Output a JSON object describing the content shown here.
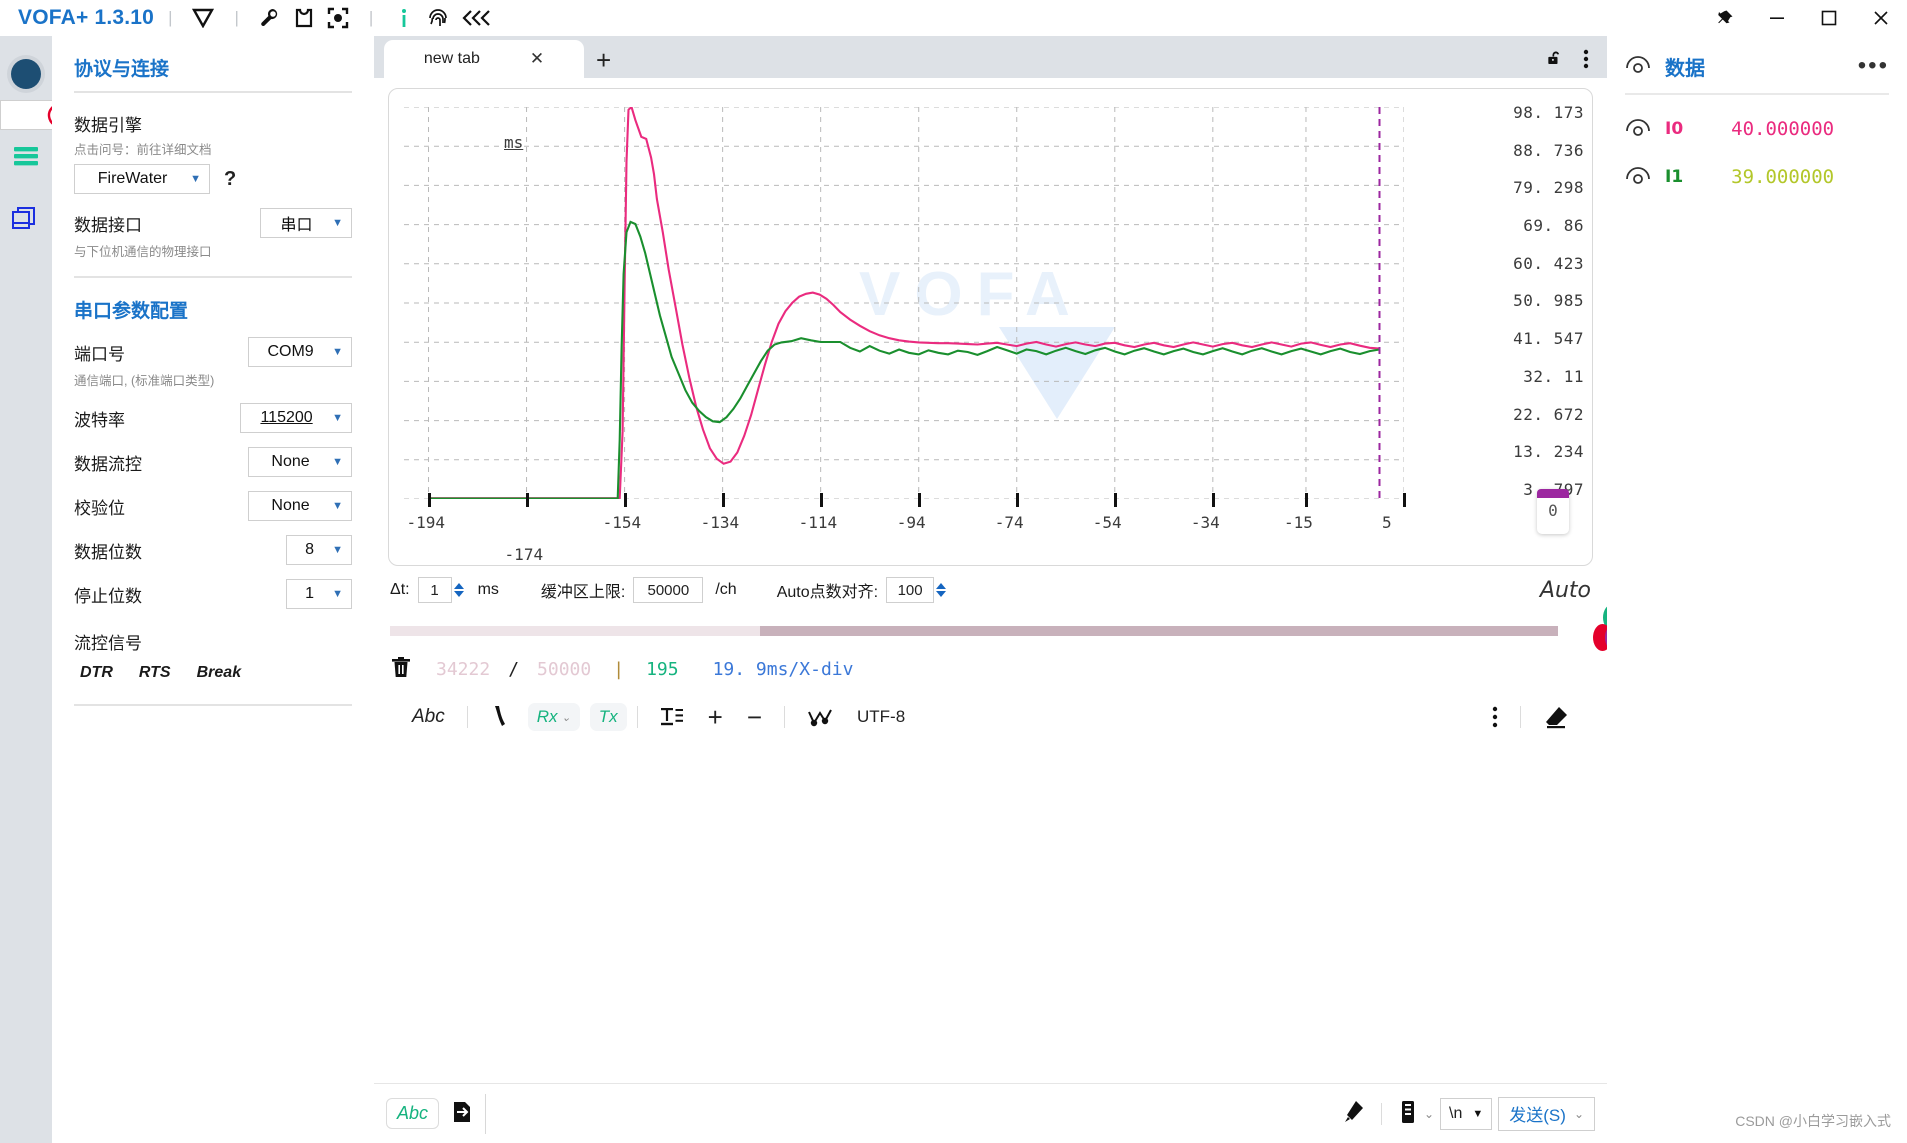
{
  "titlebar": {
    "brand": "VOFA+ 1.3.10",
    "icons": [
      {
        "name": "vofa-logo-icon",
        "glyph": "V"
      },
      {
        "name": "wrench-icon",
        "glyph": "wrench"
      },
      {
        "name": "shirt-icon",
        "glyph": "shirt"
      },
      {
        "name": "focus-icon",
        "glyph": "focus"
      },
      {
        "name": "info-icon",
        "glyph": "i"
      },
      {
        "name": "fingerprint-icon",
        "glyph": "fingerprint"
      },
      {
        "name": "collapse-icon",
        "glyph": "«‹"
      }
    ],
    "window": {
      "pin": "pin-icon",
      "minimize": "–",
      "maximize": "☐",
      "close": "✕"
    }
  },
  "rail": {
    "items": [
      {
        "name": "connection-status-indicator",
        "selected": false
      },
      {
        "name": "record-icon",
        "selected": true
      },
      {
        "name": "menu-lines-icon",
        "selected": false
      },
      {
        "name": "windows-stack-icon",
        "selected": false
      }
    ]
  },
  "sidebar": {
    "section1_title": "协议与连接",
    "engine": {
      "label": "数据引擎",
      "hint": "点击问号：前往详细文档",
      "value": "FireWater",
      "help": "?"
    },
    "interface": {
      "label": "数据接口",
      "value": "串口",
      "hint": "与下位机通信的物理接口"
    },
    "section2_title": "串口参数配置",
    "port": {
      "label": "端口号",
      "value": "COM9",
      "hint": "通信端口, (标准端口类型)"
    },
    "rows": [
      {
        "label": "波特率",
        "value": "115200",
        "underline": true
      },
      {
        "label": "数据流控",
        "value": "None",
        "underline": false
      },
      {
        "label": "校验位",
        "value": "None",
        "underline": false
      },
      {
        "label": "数据位数",
        "value": "8",
        "underline": false
      },
      {
        "label": "停止位数",
        "value": "1",
        "underline": false
      }
    ],
    "flow": {
      "label": "流控信号",
      "buttons": [
        "DTR",
        "RTS",
        "Break"
      ]
    }
  },
  "tabs": {
    "items": [
      {
        "label": "new tab",
        "close": "✕"
      }
    ],
    "add": "+",
    "lock_icon": "unlock-icon",
    "more_icon": "kebab-menu-icon"
  },
  "chart_data": {
    "type": "line",
    "title": "",
    "xlabel": "ms",
    "ylabel": "",
    "grid": true,
    "legend_position": "right-panel",
    "xtick_labels": [
      "-194",
      "-174",
      "-154",
      "-134",
      "-114",
      "-94",
      "-74",
      "-54",
      "-34",
      "-15",
      "5"
    ],
    "xlim": [
      -199,
      5
    ],
    "ytick_labels": [
      "98. 173",
      "88. 736",
      "79. 298",
      "69. 86",
      "60. 423",
      "50. 985",
      "41. 547",
      "32. 11",
      "22. 672",
      "13. 234",
      "3. 797"
    ],
    "ylim": [
      3.797,
      98.173
    ],
    "cursor": {
      "label": "0",
      "value_at_cursor_x": 0
    },
    "watermark": "VOFA",
    "series": [
      {
        "name": "I0",
        "color": "#ea2b7f",
        "value": "40.000000",
        "x": [
          -194,
          -180,
          -170,
          -162,
          -158,
          -155,
          -154.4,
          -154.0,
          -153.6,
          -153.2,
          -152.6,
          -151.8,
          -150.6,
          -149.6,
          -148.6,
          -148.0,
          -147.4,
          -146.2,
          -145.0,
          -143.6,
          -142.2,
          -140.8,
          -139.4,
          -138.0,
          -136.6,
          -135.2,
          -133.8,
          -132.4,
          -131.0,
          -129.6,
          -128.2,
          -126.8,
          -125.4,
          -124.0,
          -122.6,
          -121.2,
          -119.8,
          -118.4,
          -117.0,
          -115.6,
          -114.2,
          -112.8,
          -111.4,
          -110.0,
          -108,
          -106,
          -104,
          -102,
          -100,
          -98,
          -96,
          -94,
          -92,
          -90,
          -88,
          -86,
          -84,
          -82,
          -80,
          -78,
          -76,
          -74,
          -72,
          -70,
          -68,
          -66,
          -64,
          -62,
          -60,
          -58,
          -56,
          -54,
          -52,
          -50,
          -48,
          -46,
          -44,
          -42,
          -40,
          -38,
          -36,
          -34,
          -32,
          -30,
          -28,
          -26,
          -24,
          -22,
          -20,
          -18,
          -16,
          -14,
          -12,
          -10,
          -8,
          -6,
          -4,
          -2,
          0
        ],
        "y": [
          4.0,
          4.0,
          4.0,
          4.0,
          4.0,
          4.0,
          20,
          55,
          85,
          97.5,
          98.2,
          95,
          91,
          90.5,
          86,
          82,
          76,
          68,
          59,
          50,
          41,
          33,
          26,
          20.5,
          16,
          13.5,
          12.3,
          12.8,
          15,
          19,
          24,
          30,
          36,
          41.5,
          46,
          49,
          51,
          52.5,
          53.2,
          53.5,
          53.0,
          52,
          50.5,
          48.8,
          47.0,
          45.5,
          44.2,
          43.2,
          42.5,
          42.0,
          41.7,
          41.5,
          41.4,
          41.3,
          41.3,
          41.2,
          41.1,
          41.0,
          41.2,
          41.4,
          41.0,
          40.6,
          41.2,
          41.6,
          41.0,
          40.5,
          41.1,
          41.5,
          41.0,
          40.6,
          41.2,
          41.4,
          40.8,
          40.4,
          41.0,
          41.4,
          40.8,
          40.4,
          41.0,
          41.5,
          41.0,
          40.5,
          41.1,
          41.4,
          40.8,
          40.4,
          41.0,
          41.5,
          41.0,
          40.5,
          41.2,
          41.5,
          40.9,
          40.4,
          41.0,
          41.3,
          40.7,
          40.2,
          40.0
        ]
      },
      {
        "name": "I1",
        "color": "#1a8f2e",
        "value": "39.000000",
        "x": [
          -194,
          -180,
          -170,
          -162,
          -158,
          -155.4,
          -155.0,
          -154.6,
          -154.2,
          -153.6,
          -152.8,
          -151.8,
          -150.8,
          -149.8,
          -148.8,
          -147.8,
          -146.8,
          -145.6,
          -144.4,
          -143.0,
          -141.6,
          -140.2,
          -138.8,
          -137.4,
          -136.0,
          -134.6,
          -133.2,
          -131.8,
          -130.4,
          -129.0,
          -127.6,
          -126.2,
          -124.8,
          -123.4,
          -122.0,
          -120,
          -118,
          -116,
          -114,
          -112,
          -110,
          -108,
          -106,
          -104,
          -102,
          -100,
          -98,
          -96,
          -94,
          -92,
          -90,
          -88,
          -86,
          -84,
          -82,
          -80,
          -78,
          -76,
          -74,
          -72,
          -70,
          -68,
          -66,
          -64,
          -62,
          -60,
          -58,
          -56,
          -54,
          -52,
          -50,
          -48,
          -46,
          -44,
          -42,
          -40,
          -38,
          -36,
          -34,
          -32,
          -30,
          -28,
          -26,
          -24,
          -22,
          -20,
          -18,
          -16,
          -14,
          -12,
          -10,
          -8,
          -6,
          -4,
          -2,
          0
        ],
        "y": [
          3.9,
          3.9,
          3.9,
          3.9,
          3.9,
          3.9,
          18,
          40,
          58,
          68,
          70.5,
          70.0,
          67,
          63,
          58,
          53,
          48,
          43,
          38,
          34,
          30,
          27,
          25,
          23.5,
          22.5,
          22.3,
          23.5,
          25.5,
          28,
          31,
          34,
          37,
          39.5,
          41,
          41.5,
          41.8,
          42.5,
          42.0,
          41.6,
          41.6,
          41.6,
          40.2,
          39.3,
          40.6,
          39.5,
          38.8,
          39.8,
          39.0,
          38.6,
          39.6,
          39.0,
          38.6,
          39.5,
          39.2,
          38.5,
          39.4,
          40.4,
          39.6,
          38.8,
          39.8,
          39.4,
          38.6,
          39.5,
          40.2,
          39.4,
          38.7,
          39.6,
          40.2,
          39.3,
          38.6,
          39.5,
          40.1,
          39.3,
          38.6,
          39.4,
          40.0,
          39.2,
          38.6,
          39.4,
          40.1,
          39.3,
          38.6,
          39.5,
          40.1,
          39.3,
          38.6,
          39.4,
          40.0,
          39.3,
          38.6,
          39.4,
          40.0,
          39.2,
          38.7,
          39.4,
          39.8,
          39.0
        ]
      }
    ]
  },
  "controls": {
    "dt_label": "Δt:",
    "dt_value": "1",
    "dt_unit": "ms",
    "buffer_label": "缓冲区上限:",
    "buffer_value": "50000",
    "buffer_unit": "/ch",
    "align_label": "Auto点数对齐:",
    "align_value": "100",
    "auto_label": "Auto"
  },
  "status": {
    "trash_icon": "trash-icon",
    "used": "34222",
    "slash": "/",
    "total": "50000",
    "bar": "|",
    "points": "195",
    "scale": "19. 9ms/X-div"
  },
  "terminal_toolbar": {
    "abc": "Abc",
    "phone_icon": "phone-icon",
    "rx": "Rx",
    "tx": "Tx",
    "text_icon": "text-format-icon",
    "plus": "+",
    "minus": "−",
    "wave_icon": "waveform-icon",
    "encoding": "UTF-8",
    "more_icon": "kebab-menu-icon",
    "eraser_icon": "eraser-icon"
  },
  "send": {
    "abc": "Abc",
    "export_icon": "export-icon",
    "input_value": "",
    "input_placeholder": "",
    "eraser_icon": "eraser-icon",
    "list_icon": "list-icon",
    "newline": "\\n",
    "send_label": "发送(S)"
  },
  "data_panel": {
    "title": "数据",
    "eye_icon": "eye-icon",
    "more": "•••",
    "rows": [
      {
        "name": "I0",
        "value": "40.000000",
        "color": "#ea2b7f"
      },
      {
        "name": "I1",
        "value": "39.000000",
        "color": "#1a8f2e"
      }
    ]
  },
  "watermark": {
    "text": "CSDN @小白学习嵌入式"
  },
  "colors": {
    "accent": "#1a73c8",
    "ch0": "#ea2b7f",
    "ch1": "#1a8f2e",
    "cursor": "#9c27a0"
  }
}
